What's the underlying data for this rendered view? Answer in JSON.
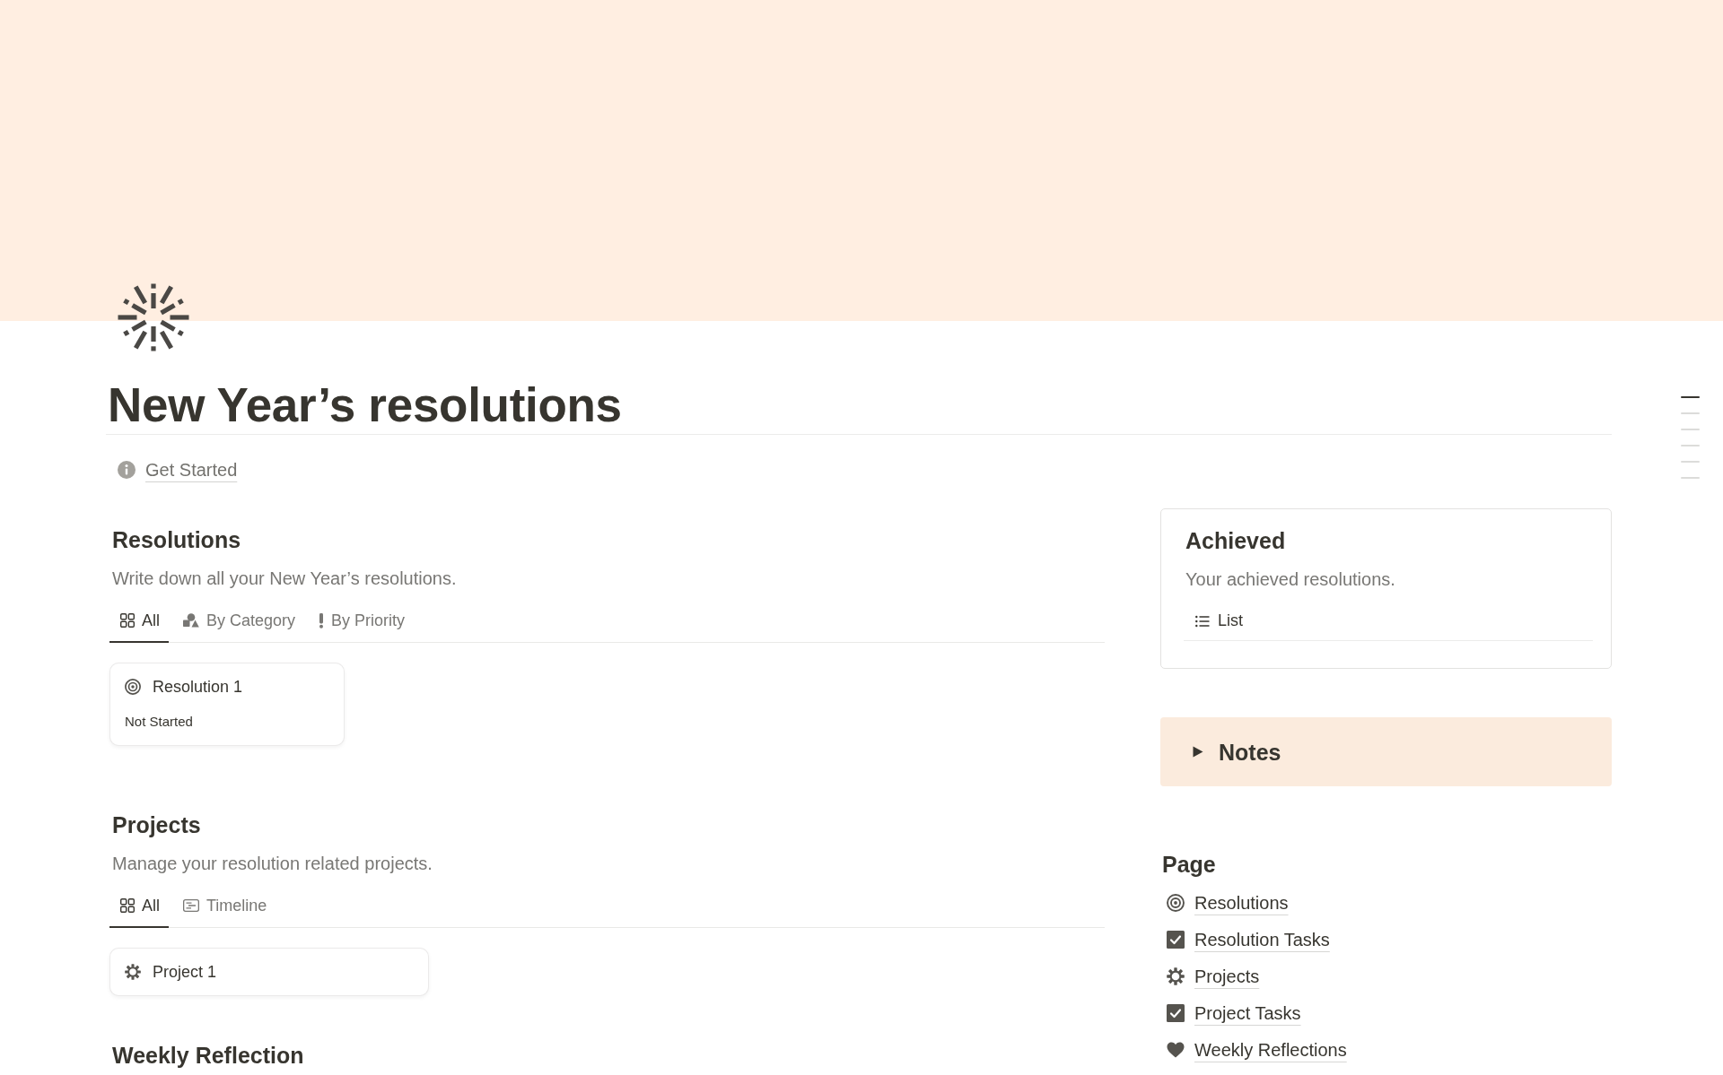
{
  "page": {
    "title": "New Year’s resolutions",
    "link": "Get Started"
  },
  "sections": [
    {
      "title": "Resolutions",
      "description": "Write down all your New Year’s resolutions.",
      "tabs": [
        {
          "label": "All",
          "kind": "gallery",
          "selected": true
        },
        {
          "label": "By Category",
          "kind": "category",
          "selected": false
        },
        {
          "label": "By Priority",
          "kind": "priority",
          "selected": false
        }
      ],
      "cards": [
        {
          "kind": "goal",
          "title": "Resolution 1",
          "status": "Not Started"
        }
      ]
    },
    {
      "title": "Projects",
      "description": "Manage your resolution related projects.",
      "tabs": [
        {
          "label": "All",
          "kind": "gallery",
          "selected": true
        },
        {
          "label": "Timeline",
          "kind": "timeline",
          "selected": false
        }
      ],
      "cards": [
        {
          "kind": "project",
          "title": "Project 1"
        }
      ]
    },
    {
      "title": "Weekly Reflection"
    }
  ],
  "achieved": {
    "title": "Achieved",
    "description": "Your achieved resolutions.",
    "views": [
      {
        "label": "List",
        "kind": "list"
      }
    ]
  },
  "toggle": {
    "title": "Notes",
    "expanded": false
  },
  "page_links": {
    "title": "Page",
    "items": [
      {
        "kind": "goal",
        "label": "Resolutions"
      },
      {
        "kind": "task",
        "label": "Resolution Tasks"
      },
      {
        "kind": "project",
        "label": "Projects"
      },
      {
        "kind": "task",
        "label": "Project Tasks"
      },
      {
        "kind": "reflection",
        "label": "Weekly Reflections"
      }
    ]
  },
  "outline": [
    {
      "selected": true
    },
    {
      "selected": false
    },
    {
      "selected": false
    },
    {
      "selected": false
    },
    {
      "selected": false
    },
    {
      "selected": false
    }
  ]
}
